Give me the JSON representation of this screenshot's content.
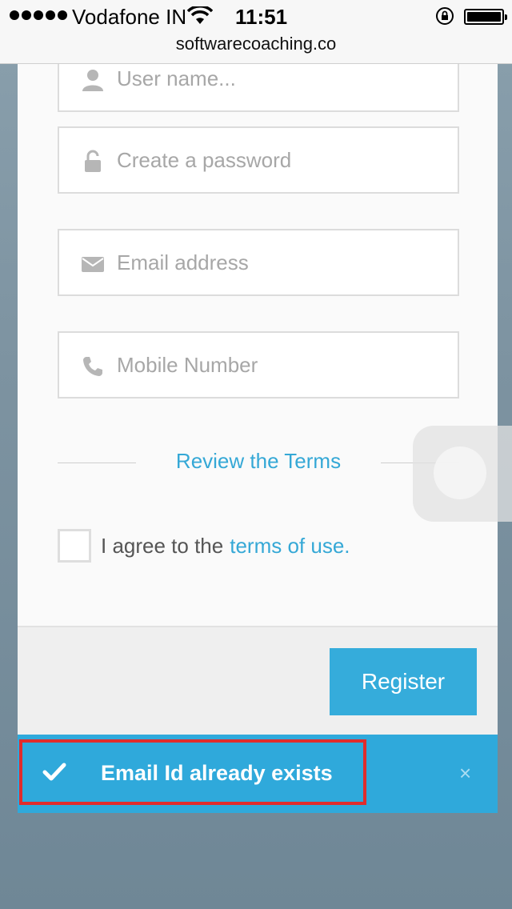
{
  "status_bar": {
    "carrier": "Vodafone IN",
    "time": "11:51"
  },
  "browser": {
    "url": "softwarecoaching.co"
  },
  "form": {
    "username_placeholder": "User name...",
    "password_placeholder": "Create a password",
    "email_placeholder": "Email address",
    "mobile_placeholder": "Mobile Number",
    "review_terms": "Review the Terms",
    "agree_text": "I agree to the",
    "terms_link": "terms of use.",
    "register_label": "Register"
  },
  "toast": {
    "message": "Email Id already exists",
    "close": "×"
  },
  "colors": {
    "accent": "#35acdb",
    "highlight": "#e02c2c"
  }
}
